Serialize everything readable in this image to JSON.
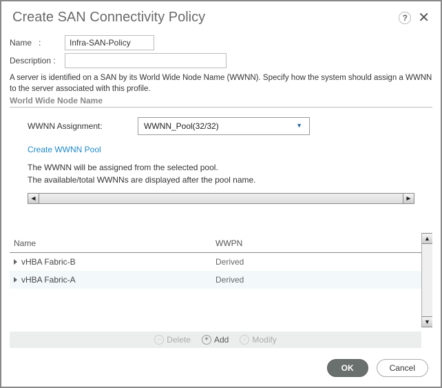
{
  "dialog": {
    "title": "Create SAN Connectivity Policy",
    "help_tooltip": "?"
  },
  "form": {
    "name_label": "Name",
    "name_value": "Infra-SAN-Policy",
    "desc_label": "Description :",
    "desc_value": "",
    "info_text": "A server is identified on a SAN by its World Wide Node Name (WWNN). Specify how the system should assign a WWNN to the server associated with this profile."
  },
  "wwnn": {
    "section_title": "World Wide Node Name",
    "assign_label": "WWNN Assignment:",
    "assign_value": "WWNN_Pool(32/32)",
    "create_link": "Create WWNN Pool",
    "note1": "The WWNN will be assigned from the selected pool.",
    "note2": "The available/total WWNNs are displayed after the pool name."
  },
  "table": {
    "col_name": "Name",
    "col_wwpn": "WWPN",
    "rows": [
      {
        "name": "vHBA Fabric-B",
        "wwpn": "Derived"
      },
      {
        "name": "vHBA Fabric-A",
        "wwpn": "Derived"
      }
    ]
  },
  "toolbar": {
    "delete": "Delete",
    "add": "Add",
    "modify": "Modify"
  },
  "footer": {
    "ok": "OK",
    "cancel": "Cancel"
  }
}
